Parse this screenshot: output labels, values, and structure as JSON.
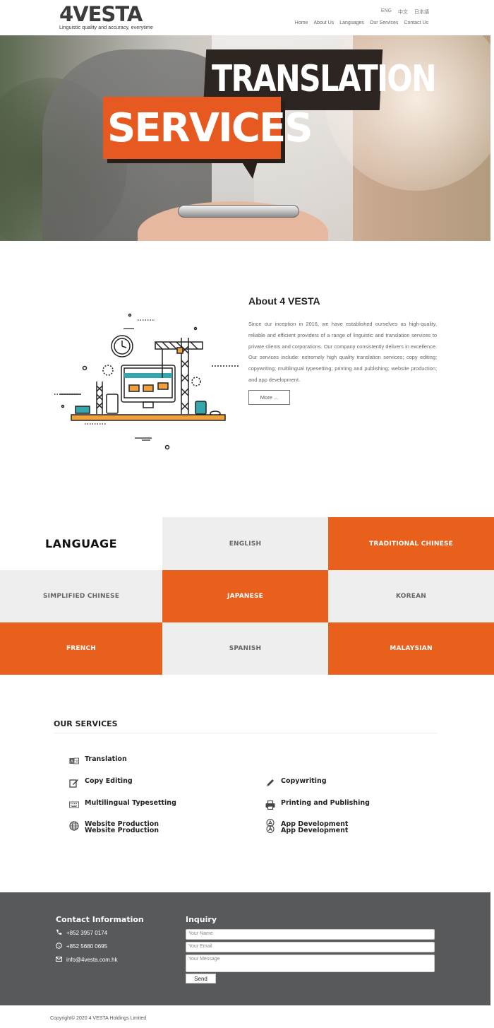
{
  "header": {
    "logo": "4VESTA",
    "tagline": "Linguistic quality and accuracy, everytime",
    "lang_switch": [
      "ENG",
      "中文",
      "日本語"
    ],
    "nav": [
      "Home",
      "About Us",
      "Languages",
      "Our Services",
      "Contact Us"
    ]
  },
  "hero": {
    "line1": "TRANSLATION",
    "line2": "SERVICES"
  },
  "about": {
    "title": "About 4 VESTA",
    "body": "Since our inception in 2016, we have established ourselves as high-quality, reliable and efficient providers of a range of linguistic and translation services to private clients and corporations. Our company consistently delivers in excellence. Our services include: extremely high quality translation services; copy editing; copywriting; multilingual typesetting; printing and publishing; website production; and app development.",
    "more_button": "More ..."
  },
  "languages": {
    "title": "LANGUAGE",
    "items": [
      "ENGLISH",
      "TRADITIONAL CHINESE",
      "SIMPLIFIED CHINESE",
      "JAPANESE",
      "KOREAN",
      "FRENCH",
      "SPANISH",
      "MALAYSIAN"
    ]
  },
  "services": {
    "title": "OUR SERVICES",
    "items": [
      {
        "label": "Translation",
        "icon": "translate-icon"
      },
      {
        "label": "Copy Editing",
        "icon": "edit-icon"
      },
      {
        "label": "Copywriting",
        "icon": "pencil-icon"
      },
      {
        "label": "Multilingual Typesetting",
        "icon": "keyboard-icon"
      },
      {
        "label": "Printing and Publishing",
        "icon": "printer-icon"
      },
      {
        "label": "Website Production",
        "icon": "globe-icon"
      },
      {
        "label": "App Development",
        "icon": "app-store-icon"
      }
    ]
  },
  "footer": {
    "contact_title": "Contact Information",
    "phone": "+852 3957 0174",
    "whatsapp": "+852 5680 0695",
    "email": "info@4vesta.com.hk",
    "inquiry_title": "Inquiry",
    "name_placeholder": "Your Name",
    "email_placeholder": "Your Email",
    "message_placeholder": "Your Message",
    "send_label": "Send",
    "copyright": "Copyright© 2020 4 VESTA Holdings Limited"
  },
  "colors": {
    "accent": "#e8601c",
    "grey_cell": "#eeeeee",
    "footer_bg": "#58595b"
  }
}
